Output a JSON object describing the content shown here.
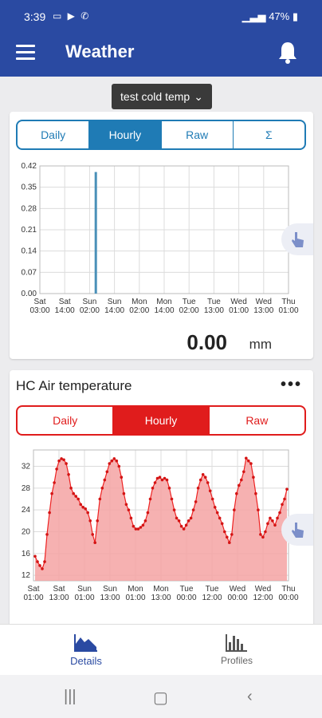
{
  "status_bar": {
    "time": "3:39",
    "battery": "47%"
  },
  "app_bar": {
    "title": "Weather"
  },
  "profile_select": {
    "label": "test cold temp"
  },
  "precip_card": {
    "tabs": [
      "Daily",
      "Hourly",
      "Raw",
      "Σ"
    ],
    "active_tab": "Hourly",
    "value": "0.00",
    "unit": "mm"
  },
  "temp_card": {
    "title": "HC Air temperature",
    "tabs": [
      "Daily",
      "Hourly",
      "Raw"
    ],
    "active_tab": "Hourly"
  },
  "bottom_nav": {
    "details": "Details",
    "profiles": "Profiles"
  },
  "colors": {
    "primary": "#2a4aa2",
    "precip_accent": "#1f7bb5",
    "temp_accent": "#e01c1c",
    "temp_fill": "#f4a3a3"
  },
  "chart_data": [
    {
      "type": "bar",
      "yticks": [
        "0.00",
        "0.07",
        "0.14",
        "0.21",
        "0.28",
        "0.35",
        "0.42"
      ],
      "ylim": [
        0,
        0.42
      ],
      "x_tick_labels_top": [
        "Sat",
        "Sat",
        "Sun",
        "Sun",
        "Mon",
        "Mon",
        "Tue",
        "Tue",
        "Wed",
        "Wed",
        "Thu"
      ],
      "x_tick_labels_bottom": [
        "03:00",
        "14:00",
        "02:00",
        "14:00",
        "02:00",
        "14:00",
        "02:00",
        "13:00",
        "01:00",
        "13:00",
        "01:00"
      ],
      "series": [
        {
          "values": [
            {
              "x_index": 2.25,
              "y": 0.4
            }
          ]
        }
      ],
      "grid": true
    },
    {
      "type": "area",
      "yticks": [
        "12",
        "16",
        "20",
        "24",
        "28",
        "32"
      ],
      "ylim": [
        11,
        35
      ],
      "x_tick_labels_top": [
        "Sat",
        "Sat",
        "Sun",
        "Sun",
        "Mon",
        "Mon",
        "Tue",
        "Tue",
        "Wed",
        "Wed",
        "Thu"
      ],
      "x_tick_labels_bottom": [
        "01:00",
        "13:00",
        "01:00",
        "13:00",
        "01:00",
        "13:00",
        "00:00",
        "12:00",
        "00:00",
        "12:00",
        "00:00"
      ],
      "series": [
        {
          "values": [
            15.5,
            14.5,
            13.8,
            13.2,
            14.5,
            19.5,
            23.5,
            27,
            29,
            31.5,
            33,
            33.4,
            33.2,
            32.5,
            30.5,
            28,
            27,
            26.5,
            26,
            25,
            24.5,
            24.2,
            23.5,
            22,
            19.5,
            18,
            22,
            26,
            28,
            29.5,
            31,
            32.5,
            33,
            33.4,
            33,
            32,
            30,
            27,
            25,
            24,
            22.5,
            21,
            20.5,
            20.5,
            20.8,
            21.2,
            22,
            23.5,
            26,
            28,
            29,
            29.8,
            30,
            29.5,
            29.8,
            29.5,
            28,
            26,
            24,
            22.5,
            22,
            21,
            20.5,
            21.2,
            22,
            22.5,
            24,
            25.5,
            28,
            29.5,
            30.5,
            30,
            29,
            27.5,
            26,
            24.5,
            23.5,
            22.5,
            21.5,
            20,
            19,
            18,
            19.5,
            24,
            27,
            28.5,
            29.5,
            31,
            33.5,
            33,
            32.5,
            30,
            27,
            24,
            19.5,
            19,
            20,
            21.5,
            22.5,
            22,
            21.2,
            22.5,
            23.5,
            25,
            26,
            27.8
          ]
        }
      ],
      "grid": true
    }
  ]
}
